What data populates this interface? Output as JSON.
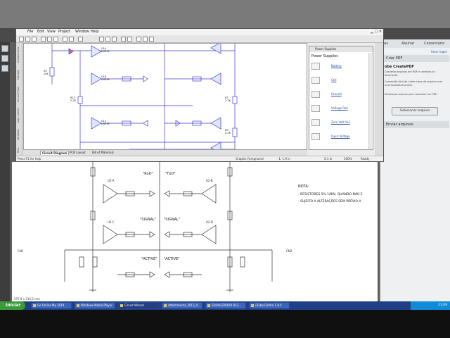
{
  "pdf_viewer": {
    "right_panel": {
      "tabs": [
        "ntas",
        "Assinar",
        "Comentário"
      ],
      "login": "Fazer logon",
      "section_create": "Criar PDF",
      "brand": "obe CreatePDF",
      "desc1": "Converta arquivos em PDF e combine-os facilmente",
      "desc2": "Conversão fácil de vários tipos de arquivo com uma assinatura online.",
      "desc3": "Selecionar arquivo para converter em PDF:",
      "select_button": "Selecionar arquivo",
      "section_send": "Enviar arquivos"
    },
    "page_label": "297,8 x 210,2 mm",
    "schematic": {
      "labels_top": [
        "\"RxD\"",
        "\"TxD\""
      ],
      "labels_mid": [
        "\"SIGNAL\"",
        "\"SIGNAL\""
      ],
      "labels_bot": [
        "\"ACTIVE\"",
        "\"ACTIVE\""
      ],
      "note_title": "NOTA:",
      "note_lines": [
        "- RESISTORES 5% 1/8W, QUANDO NÃO E",
        "- SUJEITO A ALTERAÇÕES SEM PRÉVIO A"
      ]
    }
  },
  "app": {
    "menu": [
      "File",
      "Edit",
      "View",
      "Project",
      "Window",
      "Help"
    ],
    "canvas_labels": [
      "U1A\nLM339",
      "U1B\nLM339",
      "U1C\nLM339",
      "R3\n10K",
      "R13\n2.2K",
      "R7\n2.2K",
      "R9\n2.2K",
      "R14\n2.2K"
    ],
    "view_tabs": [
      "Circuit Diagram",
      "PCB Layout",
      "Bill of Materials"
    ],
    "status": {
      "left": "Press F1 for help",
      "layer": "Graphic Foreground",
      "coords": "-1, 1.9 in",
      "zoom": "0.1 in",
      "percent": "100%",
      "ready": "Ready"
    },
    "parts_panel": {
      "title": "Power Supplies",
      "heading": "Power Supplies",
      "items": [
        "Battery",
        "Cell",
        "Ground",
        "Voltage Rail",
        "Zero Volt Rail",
        "Input Voltage"
      ]
    },
    "vertical_tabs": [
      "Components",
      "Manage",
      "Circuit Props",
      "Logic Levels",
      "Variables",
      "Misc"
    ]
  },
  "taskbar": {
    "start": "Iniciar",
    "tasks": [
      "Go Online My 2019",
      "Windows Media Player",
      "Circuit Wizard",
      "attachments_2013_0...",
      "EQUALIZADOR RL2...",
      "uTube Gehlm 1.8.5"
    ],
    "clock": "21:09"
  }
}
